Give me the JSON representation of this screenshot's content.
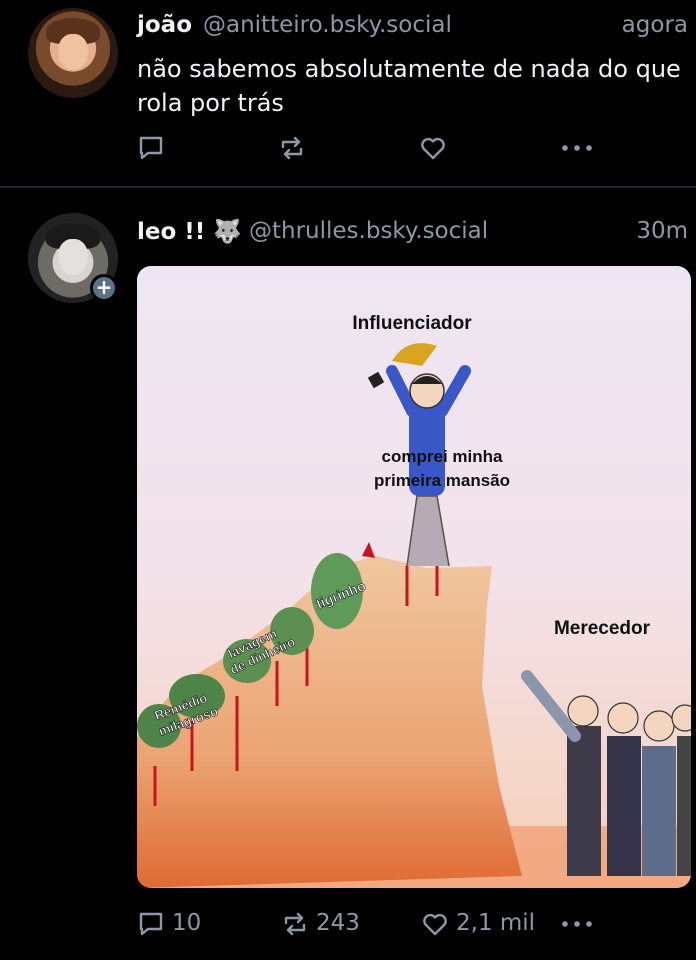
{
  "posts": [
    {
      "display_name": "joão",
      "handle": "@anitteiro.bsky.social",
      "time": "agora",
      "text": "não sabemos absolutamente de nada do que rola por trás",
      "actions": {
        "reply": "",
        "repost": "",
        "like": ""
      }
    },
    {
      "display_name": "leo !! 🐺",
      "handle": "@thrulles.bsky.social",
      "time": "30m",
      "follow_badge": "+",
      "actions": {
        "reply": "10",
        "repost": "243",
        "like": "2,1 mil"
      },
      "meme": {
        "top_label": "Influenciador",
        "quote": [
          "comprei minha",
          "primeira mansão"
        ],
        "right_label": "Merecedor",
        "cactus_labels": [
          "tigrinho",
          "lavagem",
          "de dinheiro",
          "Remédio",
          "milagroso"
        ]
      }
    }
  ],
  "colors": {
    "background": "#000000",
    "text": "#f1f3f5",
    "muted": "#8b98a5",
    "divider": "#1e2731"
  },
  "icons": [
    "reply-icon",
    "repost-icon",
    "like-icon",
    "more-icon",
    "follow-plus-icon"
  ]
}
